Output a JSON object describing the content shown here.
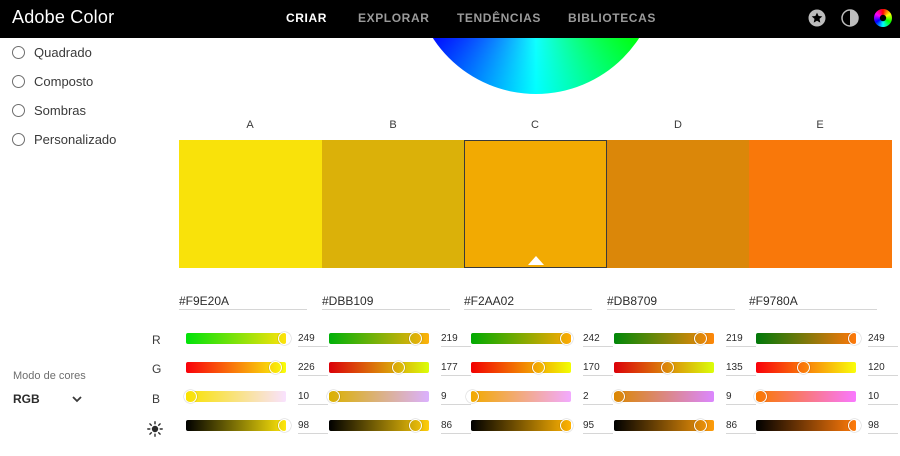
{
  "header": {
    "brand": "Adobe Color",
    "nav": [
      {
        "label": "CRIAR",
        "active": true
      },
      {
        "label": "EXPLORAR",
        "active": false
      },
      {
        "label": "TENDÊNCIAS",
        "active": false
      },
      {
        "label": "BIBLIOTECAS",
        "active": false
      }
    ],
    "icons": [
      "star-icon",
      "theme-toggle-icon",
      "color-wheel-avatar-icon"
    ]
  },
  "harmony_rules": [
    "Quadrado",
    "Composto",
    "Sombras",
    "Personalizado"
  ],
  "color_mode": {
    "label": "Modo de cores",
    "value": "RGB"
  },
  "row_labels": {
    "r": "R",
    "g": "G",
    "b": "B"
  },
  "selected_swatch": "C",
  "swatches": [
    {
      "letter": "A",
      "hex": "#F9E20A",
      "r": 249,
      "g": 226,
      "b": 10,
      "brightness": 98
    },
    {
      "letter": "B",
      "hex": "#DBB109",
      "r": 219,
      "g": 177,
      "b": 9,
      "brightness": 86
    },
    {
      "letter": "C",
      "hex": "#F2AA02",
      "r": 242,
      "g": 170,
      "b": 2,
      "brightness": 95
    },
    {
      "letter": "D",
      "hex": "#DB8709",
      "r": 219,
      "g": 135,
      "b": 9,
      "brightness": 86
    },
    {
      "letter": "E",
      "hex": "#F9780A",
      "r": 249,
      "g": 120,
      "b": 10,
      "brightness": 98
    }
  ]
}
